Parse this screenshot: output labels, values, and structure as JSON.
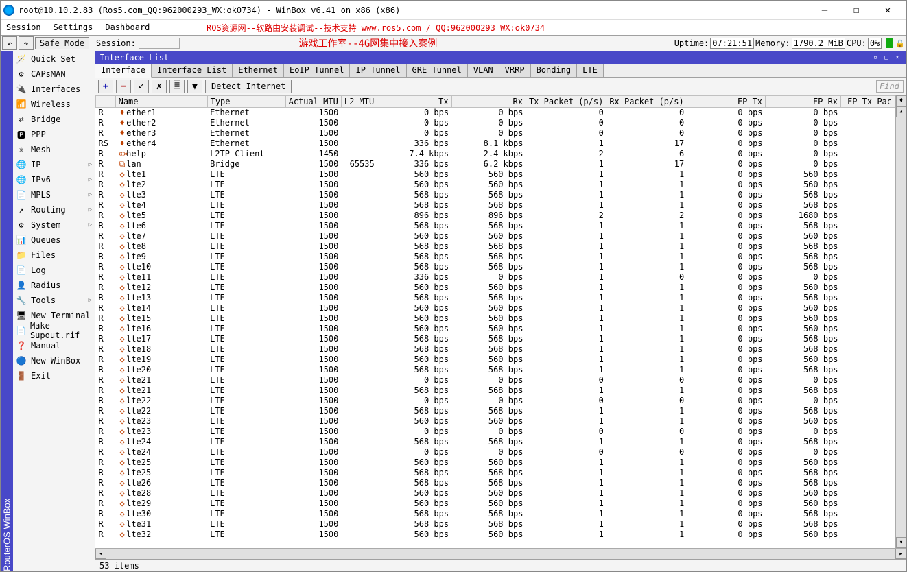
{
  "window": {
    "title": "root@10.10.2.83 (Ros5.com_QQ:962000293_WX:ok0734) - WinBox v6.41 on x86 (x86)"
  },
  "menubar": {
    "items": [
      "Session",
      "Settings",
      "Dashboard"
    ],
    "red_text": "ROS资源网--软路由安装调试--技术支持 www.ros5.com  /  QQ:962000293  WX:ok0734"
  },
  "toolbar": {
    "safemode": "Safe Mode",
    "session_label": "Session:",
    "red_text": "游戏工作室--4G网集中接入案例",
    "uptime_label": "Uptime:",
    "uptime_value": "07:21:51",
    "memory_label": "Memory:",
    "memory_value": "1790.2 MiB",
    "cpu_label": "CPU:",
    "cpu_value": "0%"
  },
  "side_title": "RouterOS WinBox",
  "sidebar": [
    {
      "icon": "🪄",
      "label": "Quick Set",
      "arrow": false
    },
    {
      "icon": "⚙",
      "label": "CAPsMAN",
      "arrow": false
    },
    {
      "icon": "🔌",
      "label": "Interfaces",
      "arrow": false
    },
    {
      "icon": "📶",
      "label": "Wireless",
      "arrow": false
    },
    {
      "icon": "⇄",
      "label": "Bridge",
      "arrow": false
    },
    {
      "icon": "🅿",
      "label": "PPP",
      "arrow": false
    },
    {
      "icon": "✳",
      "label": "Mesh",
      "arrow": false
    },
    {
      "icon": "🌐",
      "label": "IP",
      "arrow": true
    },
    {
      "icon": "🌐",
      "label": "IPv6",
      "arrow": true
    },
    {
      "icon": "📄",
      "label": "MPLS",
      "arrow": true
    },
    {
      "icon": "↗",
      "label": "Routing",
      "arrow": true
    },
    {
      "icon": "⚙",
      "label": "System",
      "arrow": true
    },
    {
      "icon": "📊",
      "label": "Queues",
      "arrow": false
    },
    {
      "icon": "📁",
      "label": "Files",
      "arrow": false
    },
    {
      "icon": "📄",
      "label": "Log",
      "arrow": false
    },
    {
      "icon": "👤",
      "label": "Radius",
      "arrow": false
    },
    {
      "icon": "🔧",
      "label": "Tools",
      "arrow": true
    },
    {
      "icon": "🖥",
      "label": "New Terminal",
      "arrow": false
    },
    {
      "icon": "📄",
      "label": "Make Supout.rif",
      "arrow": false
    },
    {
      "icon": "❓",
      "label": "Manual",
      "arrow": false
    },
    {
      "icon": "🔵",
      "label": "New WinBox",
      "arrow": false
    },
    {
      "icon": "🚪",
      "label": "Exit",
      "arrow": false
    }
  ],
  "panel": {
    "title": "Interface List",
    "tabs": [
      "Interface",
      "Interface List",
      "Ethernet",
      "EoIP Tunnel",
      "IP Tunnel",
      "GRE Tunnel",
      "VLAN",
      "VRRP",
      "Bonding",
      "LTE"
    ],
    "active_tab": 0,
    "detect_label": "Detect Internet",
    "find_placeholder": "Find"
  },
  "columns": [
    "",
    "Name",
    "Type",
    "Actual MTU",
    "L2 MTU",
    "Tx",
    "Rx",
    "Tx Packet (p/s)",
    "Rx Packet (p/s)",
    "FP Tx",
    "FP Rx",
    "FP Tx Pac"
  ],
  "rows": [
    {
      "f": "R",
      "ic": "♦",
      "n": "ether1",
      "t": "Ethernet",
      "mtu": "1500",
      "l2": "",
      "tx": "0 bps",
      "rx": "0 bps",
      "txp": "0",
      "rxp": "0",
      "fptx": "0 bps",
      "fprx": "0 bps"
    },
    {
      "f": "R",
      "ic": "♦",
      "n": "ether2",
      "t": "Ethernet",
      "mtu": "1500",
      "l2": "",
      "tx": "0 bps",
      "rx": "0 bps",
      "txp": "0",
      "rxp": "0",
      "fptx": "0 bps",
      "fprx": "0 bps"
    },
    {
      "f": "R",
      "ic": "♦",
      "n": "ether3",
      "t": "Ethernet",
      "mtu": "1500",
      "l2": "",
      "tx": "0 bps",
      "rx": "0 bps",
      "txp": "0",
      "rxp": "0",
      "fptx": "0 bps",
      "fprx": "0 bps"
    },
    {
      "f": "RS",
      "ic": "♦",
      "n": "ether4",
      "t": "Ethernet",
      "mtu": "1500",
      "l2": "",
      "tx": "336 bps",
      "rx": "8.1 kbps",
      "txp": "1",
      "rxp": "17",
      "fptx": "0 bps",
      "fprx": "0 bps"
    },
    {
      "f": "R",
      "ic": "«»",
      "n": "help",
      "t": "L2TP Client",
      "mtu": "1450",
      "l2": "",
      "tx": "7.4 kbps",
      "rx": "2.4 kbps",
      "txp": "2",
      "rxp": "6",
      "fptx": "0 bps",
      "fprx": "0 bps"
    },
    {
      "f": "R",
      "ic": "⧉",
      "n": "lan",
      "t": "Bridge",
      "mtu": "1500",
      "l2": "65535",
      "tx": "336 bps",
      "rx": "6.2 kbps",
      "txp": "1",
      "rxp": "17",
      "fptx": "0 bps",
      "fprx": "0 bps"
    },
    {
      "f": "R",
      "ic": "◇",
      "n": "lte1",
      "t": "LTE",
      "mtu": "1500",
      "l2": "",
      "tx": "560 bps",
      "rx": "560 bps",
      "txp": "1",
      "rxp": "1",
      "fptx": "0 bps",
      "fprx": "560 bps"
    },
    {
      "f": "R",
      "ic": "◇",
      "n": "lte2",
      "t": "LTE",
      "mtu": "1500",
      "l2": "",
      "tx": "560 bps",
      "rx": "560 bps",
      "txp": "1",
      "rxp": "1",
      "fptx": "0 bps",
      "fprx": "560 bps"
    },
    {
      "f": "R",
      "ic": "◇",
      "n": "lte3",
      "t": "LTE",
      "mtu": "1500",
      "l2": "",
      "tx": "568 bps",
      "rx": "568 bps",
      "txp": "1",
      "rxp": "1",
      "fptx": "0 bps",
      "fprx": "568 bps"
    },
    {
      "f": "R",
      "ic": "◇",
      "n": "lte4",
      "t": "LTE",
      "mtu": "1500",
      "l2": "",
      "tx": "568 bps",
      "rx": "568 bps",
      "txp": "1",
      "rxp": "1",
      "fptx": "0 bps",
      "fprx": "568 bps"
    },
    {
      "f": "R",
      "ic": "◇",
      "n": "lte5",
      "t": "LTE",
      "mtu": "1500",
      "l2": "",
      "tx": "896 bps",
      "rx": "896 bps",
      "txp": "2",
      "rxp": "2",
      "fptx": "0 bps",
      "fprx": "1680 bps"
    },
    {
      "f": "R",
      "ic": "◇",
      "n": "lte6",
      "t": "LTE",
      "mtu": "1500",
      "l2": "",
      "tx": "568 bps",
      "rx": "568 bps",
      "txp": "1",
      "rxp": "1",
      "fptx": "0 bps",
      "fprx": "568 bps"
    },
    {
      "f": "R",
      "ic": "◇",
      "n": "lte7",
      "t": "LTE",
      "mtu": "1500",
      "l2": "",
      "tx": "560 bps",
      "rx": "560 bps",
      "txp": "1",
      "rxp": "1",
      "fptx": "0 bps",
      "fprx": "560 bps"
    },
    {
      "f": "R",
      "ic": "◇",
      "n": "lte8",
      "t": "LTE",
      "mtu": "1500",
      "l2": "",
      "tx": "568 bps",
      "rx": "568 bps",
      "txp": "1",
      "rxp": "1",
      "fptx": "0 bps",
      "fprx": "568 bps"
    },
    {
      "f": "R",
      "ic": "◇",
      "n": "lte9",
      "t": "LTE",
      "mtu": "1500",
      "l2": "",
      "tx": "568 bps",
      "rx": "568 bps",
      "txp": "1",
      "rxp": "1",
      "fptx": "0 bps",
      "fprx": "568 bps"
    },
    {
      "f": "R",
      "ic": "◇",
      "n": "lte10",
      "t": "LTE",
      "mtu": "1500",
      "l2": "",
      "tx": "568 bps",
      "rx": "568 bps",
      "txp": "1",
      "rxp": "1",
      "fptx": "0 bps",
      "fprx": "568 bps"
    },
    {
      "f": "R",
      "ic": "◇",
      "n": "lte11",
      "t": "LTE",
      "mtu": "1500",
      "l2": "",
      "tx": "336 bps",
      "rx": "0 bps",
      "txp": "1",
      "rxp": "0",
      "fptx": "0 bps",
      "fprx": "0 bps"
    },
    {
      "f": "R",
      "ic": "◇",
      "n": "lte12",
      "t": "LTE",
      "mtu": "1500",
      "l2": "",
      "tx": "560 bps",
      "rx": "560 bps",
      "txp": "1",
      "rxp": "1",
      "fptx": "0 bps",
      "fprx": "560 bps"
    },
    {
      "f": "R",
      "ic": "◇",
      "n": "lte13",
      "t": "LTE",
      "mtu": "1500",
      "l2": "",
      "tx": "568 bps",
      "rx": "568 bps",
      "txp": "1",
      "rxp": "1",
      "fptx": "0 bps",
      "fprx": "568 bps"
    },
    {
      "f": "R",
      "ic": "◇",
      "n": "lte14",
      "t": "LTE",
      "mtu": "1500",
      "l2": "",
      "tx": "560 bps",
      "rx": "560 bps",
      "txp": "1",
      "rxp": "1",
      "fptx": "0 bps",
      "fprx": "560 bps"
    },
    {
      "f": "R",
      "ic": "◇",
      "n": "lte15",
      "t": "LTE",
      "mtu": "1500",
      "l2": "",
      "tx": "560 bps",
      "rx": "560 bps",
      "txp": "1",
      "rxp": "1",
      "fptx": "0 bps",
      "fprx": "560 bps"
    },
    {
      "f": "R",
      "ic": "◇",
      "n": "lte16",
      "t": "LTE",
      "mtu": "1500",
      "l2": "",
      "tx": "560 bps",
      "rx": "560 bps",
      "txp": "1",
      "rxp": "1",
      "fptx": "0 bps",
      "fprx": "560 bps"
    },
    {
      "f": "R",
      "ic": "◇",
      "n": "lte17",
      "t": "LTE",
      "mtu": "1500",
      "l2": "",
      "tx": "568 bps",
      "rx": "568 bps",
      "txp": "1",
      "rxp": "1",
      "fptx": "0 bps",
      "fprx": "568 bps"
    },
    {
      "f": "R",
      "ic": "◇",
      "n": "lte18",
      "t": "LTE",
      "mtu": "1500",
      "l2": "",
      "tx": "568 bps",
      "rx": "568 bps",
      "txp": "1",
      "rxp": "1",
      "fptx": "0 bps",
      "fprx": "568 bps"
    },
    {
      "f": "R",
      "ic": "◇",
      "n": "lte19",
      "t": "LTE",
      "mtu": "1500",
      "l2": "",
      "tx": "560 bps",
      "rx": "560 bps",
      "txp": "1",
      "rxp": "1",
      "fptx": "0 bps",
      "fprx": "560 bps"
    },
    {
      "f": "R",
      "ic": "◇",
      "n": "lte20",
      "t": "LTE",
      "mtu": "1500",
      "l2": "",
      "tx": "568 bps",
      "rx": "568 bps",
      "txp": "1",
      "rxp": "1",
      "fptx": "0 bps",
      "fprx": "568 bps"
    },
    {
      "f": "R",
      "ic": "◇",
      "n": "lte21",
      "t": "LTE",
      "mtu": "1500",
      "l2": "",
      "tx": "0 bps",
      "rx": "0 bps",
      "txp": "0",
      "rxp": "0",
      "fptx": "0 bps",
      "fprx": "0 bps"
    },
    {
      "f": "R",
      "ic": "◇",
      "n": "lte21",
      "t": "LTE",
      "mtu": "1500",
      "l2": "",
      "tx": "568 bps",
      "rx": "568 bps",
      "txp": "1",
      "rxp": "1",
      "fptx": "0 bps",
      "fprx": "568 bps"
    },
    {
      "f": "R",
      "ic": "◇",
      "n": "lte22",
      "t": "LTE",
      "mtu": "1500",
      "l2": "",
      "tx": "0 bps",
      "rx": "0 bps",
      "txp": "0",
      "rxp": "0",
      "fptx": "0 bps",
      "fprx": "0 bps"
    },
    {
      "f": "R",
      "ic": "◇",
      "n": "lte22",
      "t": "LTE",
      "mtu": "1500",
      "l2": "",
      "tx": "568 bps",
      "rx": "568 bps",
      "txp": "1",
      "rxp": "1",
      "fptx": "0 bps",
      "fprx": "568 bps"
    },
    {
      "f": "R",
      "ic": "◇",
      "n": "lte23",
      "t": "LTE",
      "mtu": "1500",
      "l2": "",
      "tx": "560 bps",
      "rx": "560 bps",
      "txp": "1",
      "rxp": "1",
      "fptx": "0 bps",
      "fprx": "560 bps"
    },
    {
      "f": "R",
      "ic": "◇",
      "n": "lte23",
      "t": "LTE",
      "mtu": "1500",
      "l2": "",
      "tx": "0 bps",
      "rx": "0 bps",
      "txp": "0",
      "rxp": "0",
      "fptx": "0 bps",
      "fprx": "0 bps"
    },
    {
      "f": "R",
      "ic": "◇",
      "n": "lte24",
      "t": "LTE",
      "mtu": "1500",
      "l2": "",
      "tx": "568 bps",
      "rx": "568 bps",
      "txp": "1",
      "rxp": "1",
      "fptx": "0 bps",
      "fprx": "568 bps"
    },
    {
      "f": "R",
      "ic": "◇",
      "n": "lte24",
      "t": "LTE",
      "mtu": "1500",
      "l2": "",
      "tx": "0 bps",
      "rx": "0 bps",
      "txp": "0",
      "rxp": "0",
      "fptx": "0 bps",
      "fprx": "0 bps"
    },
    {
      "f": "R",
      "ic": "◇",
      "n": "lte25",
      "t": "LTE",
      "mtu": "1500",
      "l2": "",
      "tx": "560 bps",
      "rx": "560 bps",
      "txp": "1",
      "rxp": "1",
      "fptx": "0 bps",
      "fprx": "560 bps"
    },
    {
      "f": "R",
      "ic": "◇",
      "n": "lte25",
      "t": "LTE",
      "mtu": "1500",
      "l2": "",
      "tx": "568 bps",
      "rx": "568 bps",
      "txp": "1",
      "rxp": "1",
      "fptx": "0 bps",
      "fprx": "568 bps"
    },
    {
      "f": "R",
      "ic": "◇",
      "n": "lte26",
      "t": "LTE",
      "mtu": "1500",
      "l2": "",
      "tx": "568 bps",
      "rx": "568 bps",
      "txp": "1",
      "rxp": "1",
      "fptx": "0 bps",
      "fprx": "568 bps"
    },
    {
      "f": "R",
      "ic": "◇",
      "n": "lte28",
      "t": "LTE",
      "mtu": "1500",
      "l2": "",
      "tx": "560 bps",
      "rx": "560 bps",
      "txp": "1",
      "rxp": "1",
      "fptx": "0 bps",
      "fprx": "560 bps"
    },
    {
      "f": "R",
      "ic": "◇",
      "n": "lte29",
      "t": "LTE",
      "mtu": "1500",
      "l2": "",
      "tx": "560 bps",
      "rx": "560 bps",
      "txp": "1",
      "rxp": "1",
      "fptx": "0 bps",
      "fprx": "560 bps"
    },
    {
      "f": "R",
      "ic": "◇",
      "n": "lte30",
      "t": "LTE",
      "mtu": "1500",
      "l2": "",
      "tx": "568 bps",
      "rx": "568 bps",
      "txp": "1",
      "rxp": "1",
      "fptx": "0 bps",
      "fprx": "568 bps"
    },
    {
      "f": "R",
      "ic": "◇",
      "n": "lte31",
      "t": "LTE",
      "mtu": "1500",
      "l2": "",
      "tx": "568 bps",
      "rx": "568 bps",
      "txp": "1",
      "rxp": "1",
      "fptx": "0 bps",
      "fprx": "568 bps"
    },
    {
      "f": "R",
      "ic": "◇",
      "n": "lte32",
      "t": "LTE",
      "mtu": "1500",
      "l2": "",
      "tx": "560 bps",
      "rx": "560 bps",
      "txp": "1",
      "rxp": "1",
      "fptx": "0 bps",
      "fprx": "560 bps"
    }
  ],
  "statusbar": "53 items"
}
